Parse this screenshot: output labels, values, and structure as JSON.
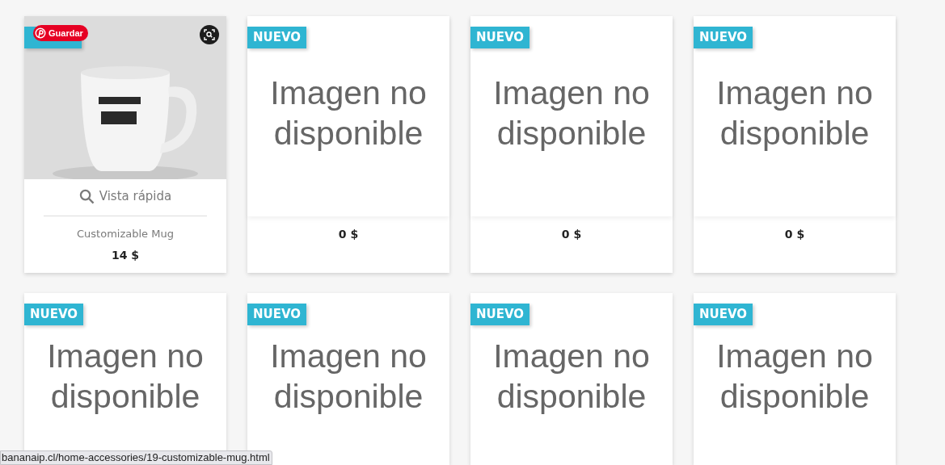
{
  "products": [
    {
      "covered_badge": true,
      "pin_button": "Guardar",
      "quick_view": "Vista rápida",
      "name": "Customizable Mug",
      "price": "14 $"
    },
    {
      "kind": "no_image",
      "badge": "NUEVO",
      "placeholder_text": "Imagen no disponible",
      "price": "0 $"
    },
    {
      "kind": "no_image",
      "badge": "NUEVO",
      "placeholder_text": "Imagen no disponible",
      "price": "0 $"
    },
    {
      "kind": "no_image",
      "badge": "NUEVO",
      "placeholder_text": "Imagen no disponible",
      "price": "0 $"
    },
    {
      "kind": "no_image",
      "badge": "NUEVO",
      "placeholder_text": "Imagen no disponible"
    },
    {
      "kind": "no_image",
      "badge": "NUEVO",
      "placeholder_text": "Imagen no disponible"
    },
    {
      "kind": "no_image",
      "badge": "NUEVO",
      "placeholder_text": "Imagen no disponible"
    },
    {
      "kind": "no_image",
      "badge": "NUEVO",
      "placeholder_text": "Imagen no disponible"
    }
  ],
  "status_bar": {
    "url": "bananaip.cl/home-accessories/19-customizable-mug.html"
  }
}
